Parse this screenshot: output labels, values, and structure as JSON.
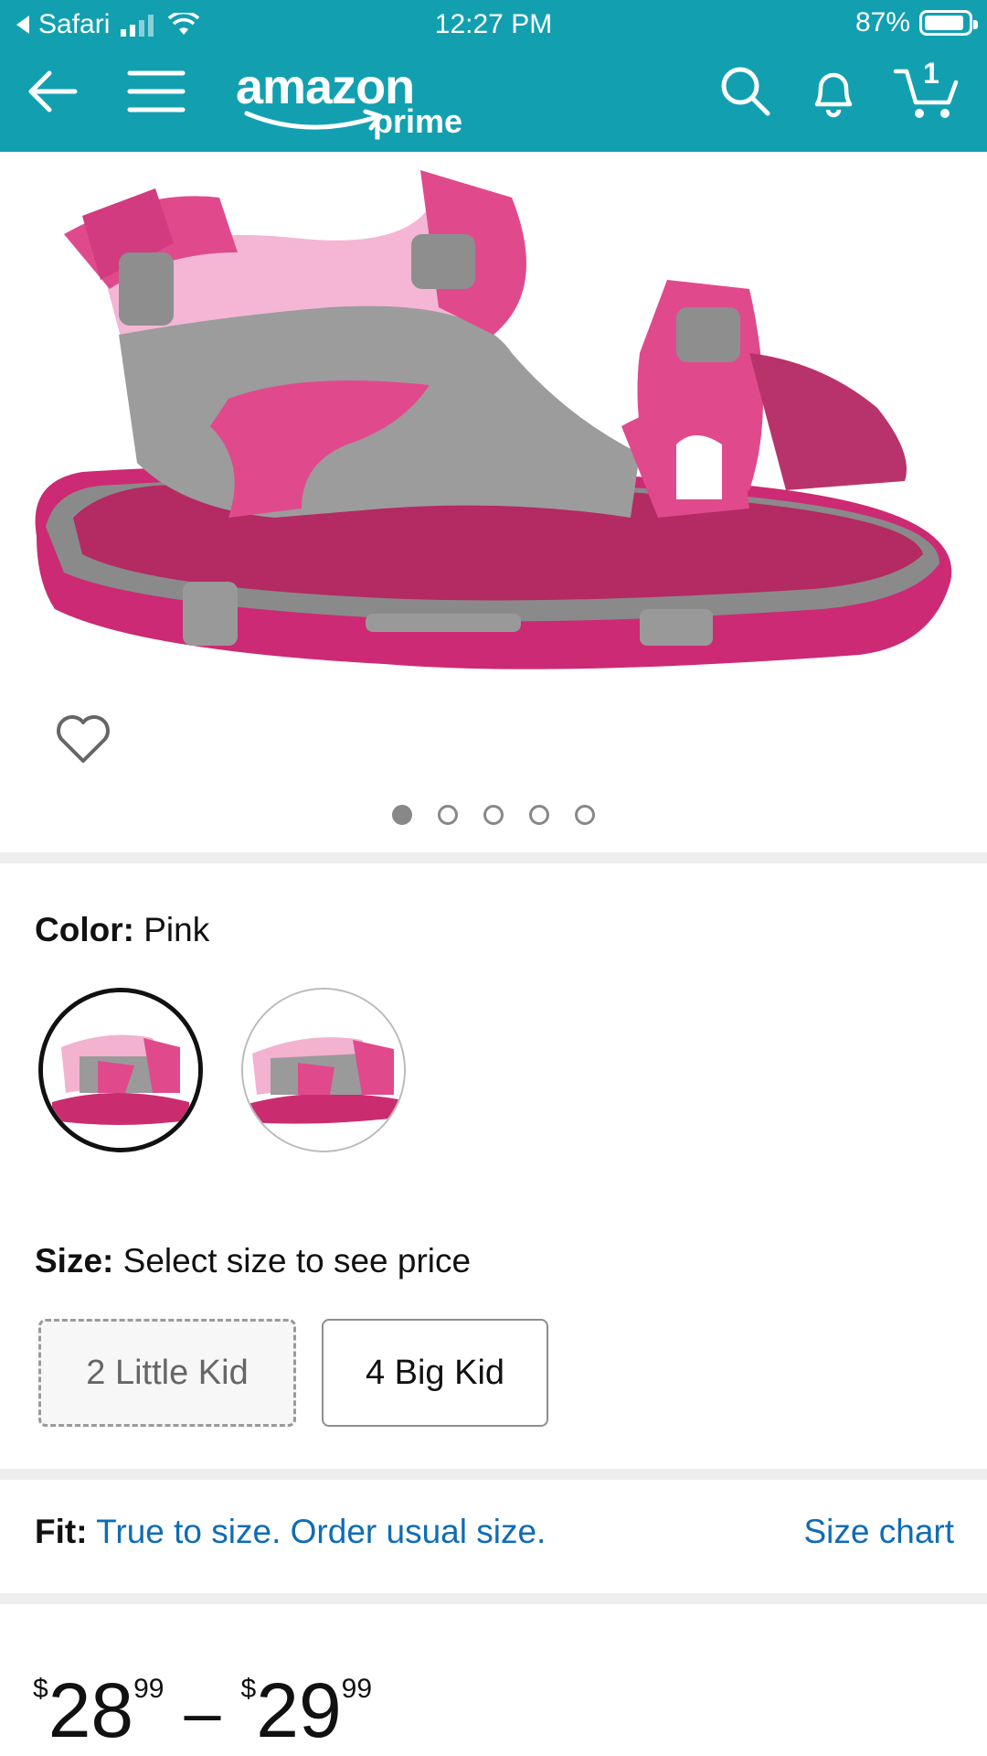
{
  "status_bar": {
    "back_app": "Safari",
    "time": "12:27 PM",
    "battery": "87%"
  },
  "header": {
    "logo_word": "amazon",
    "logo_sub": "prime",
    "cart_count": "1",
    "bg_color": "#12a0b0"
  },
  "gallery": {
    "image_count": 5,
    "active_index": 0
  },
  "color": {
    "label": "Color:",
    "value": "Pink"
  },
  "size": {
    "label": "Size:",
    "value": "Select size to see price",
    "options": [
      {
        "label": "2 Little Kid",
        "available": false
      },
      {
        "label": "4 Big Kid",
        "available": true
      }
    ]
  },
  "fit": {
    "label": "Fit:",
    "value": "True to size. Order usual size.",
    "size_chart": "Size chart"
  },
  "price": {
    "low_currency": "$",
    "low_whole": "28",
    "low_fraction": "99",
    "separator": "–",
    "high_currency": "$",
    "high_whole": "29",
    "high_fraction": "99"
  }
}
